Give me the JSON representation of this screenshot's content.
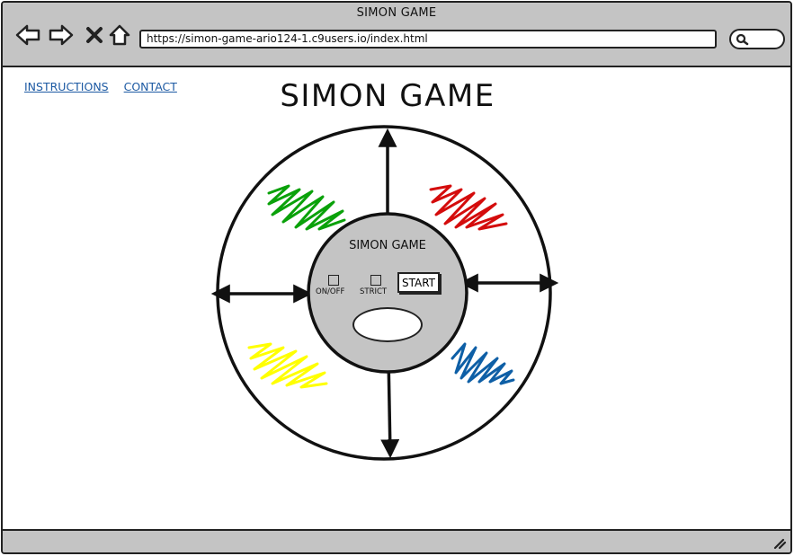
{
  "window": {
    "title": "SIMON GAME"
  },
  "browser": {
    "url": "https://simon-game-ario124-1.c9users.io/index.html",
    "icons": [
      "back-arrow-icon",
      "forward-arrow-icon",
      "close-icon",
      "home-icon",
      "search-icon"
    ]
  },
  "nav": {
    "links": [
      "INSTRUCTIONS",
      "CONTACT"
    ]
  },
  "page": {
    "title": "SIMON GAME"
  },
  "game": {
    "inner_title": "SIMON GAME",
    "on_off_label": "ON/OFF",
    "strict_label": "STRICT",
    "start_label": "START",
    "pads": [
      {
        "id": "green",
        "color": "#0aa10a"
      },
      {
        "id": "red",
        "color": "#d40c0c"
      },
      {
        "id": "yellow",
        "color": "#ffff00"
      },
      {
        "id": "blue",
        "color": "#0e5fa6"
      }
    ]
  }
}
